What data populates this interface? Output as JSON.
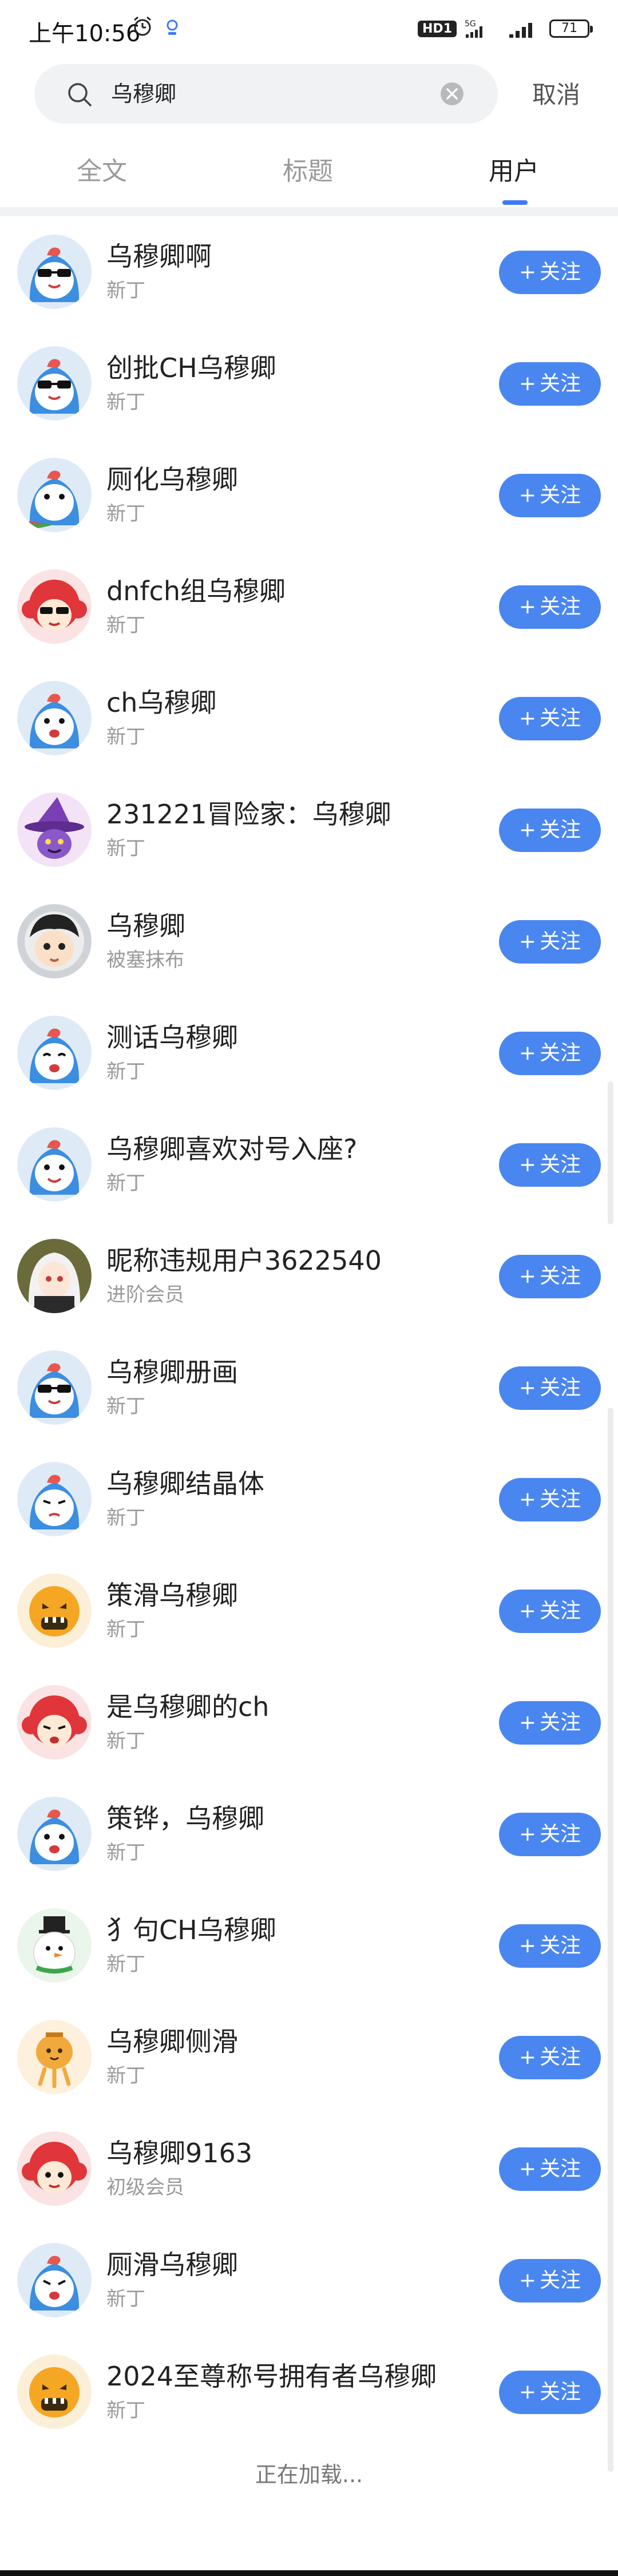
{
  "status_bar": {
    "time": "上午10:56",
    "hd_label": "HD1",
    "network": "5G",
    "battery": "71"
  },
  "search": {
    "query": "乌穆卿",
    "cancel_label": "取消"
  },
  "tabs": [
    {
      "label": "全文",
      "active": false
    },
    {
      "label": "标题",
      "active": false
    },
    {
      "label": "用户",
      "active": true
    }
  ],
  "follow_label": "关注",
  "users": [
    {
      "name": "乌穆卿啊",
      "level": "新丁",
      "avatar": "blue-bird-sunglasses-icon"
    },
    {
      "name": "创批CH乌穆卿",
      "level": "新丁",
      "avatar": "blue-bird-sunglasses-icon"
    },
    {
      "name": "厕化乌穆卿",
      "level": "新丁",
      "avatar": "blue-bird-watermelon-icon"
    },
    {
      "name": "dnfch组乌穆卿",
      "level": "新丁",
      "avatar": "red-hair-sunglasses-icon"
    },
    {
      "name": "ch乌穆卿",
      "level": "新丁",
      "avatar": "blue-bird-icon"
    },
    {
      "name": "231221冒险家：乌穆卿",
      "level": "新丁",
      "avatar": "witch-hat-icon"
    },
    {
      "name": "乌穆卿",
      "level": "被塞抹布",
      "avatar": "cartoon-boy-icon"
    },
    {
      "name": "测话乌穆卿",
      "level": "新丁",
      "avatar": "blue-bird-icon"
    },
    {
      "name": "乌穆卿喜欢对号入座?",
      "level": "新丁",
      "avatar": "blue-bird-icon"
    },
    {
      "name": "昵称违规用户3622540",
      "level": "进阶会员",
      "avatar": "anime-girl-icon"
    },
    {
      "name": "乌穆卿册画",
      "level": "新丁",
      "avatar": "blue-bird-sunglasses-icon"
    },
    {
      "name": "乌穆卿结晶体",
      "level": "新丁",
      "avatar": "blue-bird-icon"
    },
    {
      "name": "策滑乌穆卿",
      "level": "新丁",
      "avatar": "orange-monster-icon"
    },
    {
      "name": "是乌穆卿的ch",
      "level": "新丁",
      "avatar": "red-hair-icon"
    },
    {
      "name": "策铧，乌穆卿",
      "level": "新丁",
      "avatar": "blue-bird-icon"
    },
    {
      "name": "犭句CH乌穆卿",
      "level": "新丁",
      "avatar": "snowman-icon"
    },
    {
      "name": "乌穆卿侧滑",
      "level": "新丁",
      "avatar": "lantern-icon"
    },
    {
      "name": "乌穆卿9163",
      "level": "初级会员",
      "avatar": "red-hair-icon"
    },
    {
      "name": "厕滑乌穆卿",
      "level": "新丁",
      "avatar": "blue-bird-icon"
    },
    {
      "name": "2024至尊称号拥有者乌穆卿",
      "level": "新丁",
      "avatar": "orange-monster-icon"
    }
  ],
  "loading_text": "正在加载...",
  "colors": {
    "accent": "#4a86ef",
    "tab_indicator": "#3e7bf2"
  }
}
